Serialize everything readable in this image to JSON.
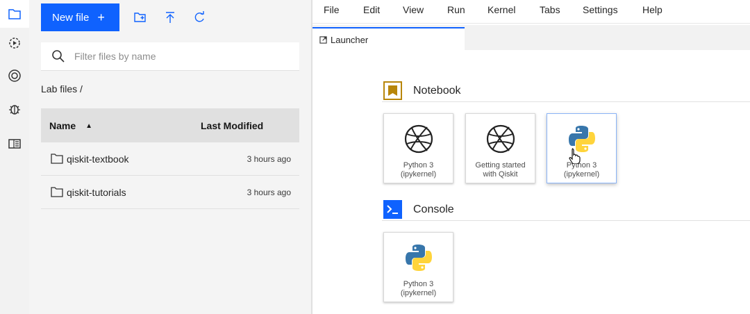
{
  "activity_bar": {
    "items": [
      {
        "icon": "folder-icon",
        "active": true
      },
      {
        "icon": "running-icon",
        "active": false
      },
      {
        "icon": "extension-icon",
        "active": false
      },
      {
        "icon": "debugger-icon",
        "active": false
      },
      {
        "icon": "toc-icon",
        "active": false
      }
    ]
  },
  "file_browser": {
    "new_file_label": "New file",
    "new_file_plus": "+",
    "toolbar_icons": [
      "new-folder-icon",
      "upload-icon",
      "refresh-icon"
    ],
    "search_placeholder": "Filter files by name",
    "breadcrumb": "Lab files /",
    "columns": {
      "name": "Name",
      "modified": "Last Modified"
    },
    "sort_indicator": "▲",
    "files": [
      {
        "name": "qiskit-textbook",
        "modified": "3 hours ago"
      },
      {
        "name": "qiskit-tutorials",
        "modified": "3 hours ago"
      }
    ]
  },
  "menubar": {
    "items": [
      "File",
      "Edit",
      "View",
      "Run",
      "Kernel",
      "Tabs",
      "Settings",
      "Help"
    ]
  },
  "tabs": [
    {
      "label": "Launcher",
      "active": true,
      "icon": "launcher-icon"
    }
  ],
  "launcher": {
    "sections": [
      {
        "title": "Notebook",
        "icon": "notebook-icon",
        "icon_color": "#b8860b",
        "cards": [
          {
            "label": "Python 3\n(ipykernel)",
            "icon": "globe-icon"
          },
          {
            "label": "Getting started\nwith Qiskit",
            "icon": "globe-icon"
          },
          {
            "label": "Python 3\n(ipykernel)",
            "icon": "python-icon",
            "hover": true
          }
        ]
      },
      {
        "title": "Console",
        "icon": "console-icon",
        "icon_color": "#0f62fe",
        "cards": [
          {
            "label": "Python 3\n(ipykernel)",
            "icon": "python-icon"
          }
        ]
      }
    ]
  },
  "colors": {
    "accent": "#0f62fe",
    "python_blue": "#3776ab",
    "python_yellow": "#ffd43b"
  }
}
